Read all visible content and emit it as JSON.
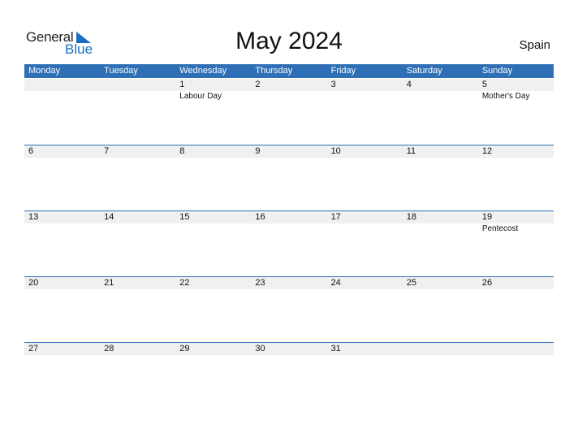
{
  "logo": {
    "general": "General",
    "blue": "Blue"
  },
  "title": "May 2024",
  "country": "Spain",
  "colors": {
    "accent": "#2e6fb5",
    "row_bg": "#f0f0f0"
  },
  "weekdays": [
    "Monday",
    "Tuesday",
    "Wednesday",
    "Thursday",
    "Friday",
    "Saturday",
    "Sunday"
  ],
  "weeks": [
    {
      "days": [
        "",
        "",
        "1",
        "2",
        "3",
        "4",
        "5"
      ],
      "holidays": [
        "",
        "",
        "Labour Day",
        "",
        "",
        "",
        "Mother's Day"
      ]
    },
    {
      "days": [
        "6",
        "7",
        "8",
        "9",
        "10",
        "11",
        "12"
      ],
      "holidays": [
        "",
        "",
        "",
        "",
        "",
        "",
        ""
      ]
    },
    {
      "days": [
        "13",
        "14",
        "15",
        "16",
        "17",
        "18",
        "19"
      ],
      "holidays": [
        "",
        "",
        "",
        "",
        "",
        "",
        "Pentecost"
      ]
    },
    {
      "days": [
        "20",
        "21",
        "22",
        "23",
        "24",
        "25",
        "26"
      ],
      "holidays": [
        "",
        "",
        "",
        "",
        "",
        "",
        ""
      ]
    },
    {
      "days": [
        "27",
        "28",
        "29",
        "30",
        "31",
        "",
        ""
      ],
      "holidays": [
        "",
        "",
        "",
        "",
        "",
        "",
        ""
      ]
    }
  ]
}
